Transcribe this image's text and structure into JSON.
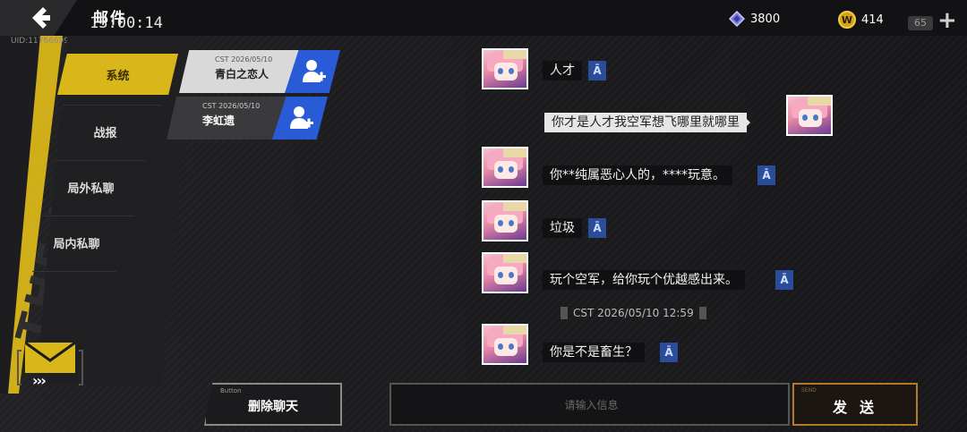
{
  "header": {
    "title": "邮件",
    "clock": "13:00:14",
    "uid": "UID:11766699",
    "gems": "3800",
    "coins": "414",
    "coin_symbol": "W",
    "stamina": "65",
    "plus": "+"
  },
  "sidebar": {
    "items": [
      {
        "label": "系统"
      },
      {
        "label": "战报"
      },
      {
        "label": "局外私聊"
      },
      {
        "label": "局内私聊"
      }
    ],
    "decor_text": "THE WAR",
    "mail_chevrons": "›››"
  },
  "contacts": [
    {
      "date": "CST 2026/05/10",
      "name": "青白之恋人"
    },
    {
      "date": "CST 2026/05/10",
      "name": "李虹遗"
    }
  ],
  "chat": {
    "translate_glyph": "Ā",
    "messages": [
      {
        "text": "人才",
        "mine": false
      },
      {
        "text": "你才是人才我空军想飞哪里就哪里",
        "mine": true
      },
      {
        "text": "你**纯属恶心人的，****玩意。",
        "mine": false
      },
      {
        "text": "垃圾",
        "mine": false
      },
      {
        "text": "玩个空军，给你玩个优越感出来。",
        "mine": false
      },
      {
        "text": "你是不是畜生？",
        "mine": false
      }
    ],
    "timestamp": "CST 2026/05/10 12:59"
  },
  "footer": {
    "delete_small": "Button",
    "delete_label": "删除聊天",
    "input_placeholder": "请输入信息",
    "send_small": "SEND",
    "send_label": "发送"
  },
  "colors": {
    "accent": "#d9b61a",
    "add_button": "#2a5bd6",
    "send_border": "#b27a2a"
  }
}
